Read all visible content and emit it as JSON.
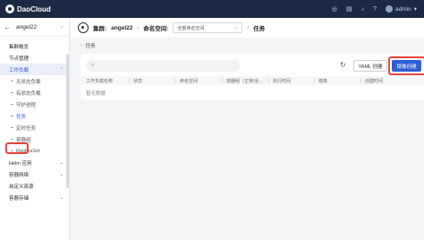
{
  "app": {
    "brand": "DaoCloud",
    "user": "admin"
  },
  "topbar": {
    "icons": [
      "globe-icon",
      "doc-icon",
      "bell-icon",
      "help-icon"
    ]
  },
  "sidebar": {
    "cluster_name": "angel22",
    "items": [
      {
        "label": "集群概览"
      },
      {
        "label": "节点管理"
      },
      {
        "label": "工作负载"
      },
      {
        "label": "无状态负载"
      },
      {
        "label": "有状态负载"
      },
      {
        "label": "守护进程"
      },
      {
        "label": "任务"
      },
      {
        "label": "定时任务"
      },
      {
        "label": "容器组"
      },
      {
        "label": "ReplicaSet"
      },
      {
        "label": "Helm 应用"
      },
      {
        "label": "容器网络"
      },
      {
        "label": "自定义资源"
      },
      {
        "label": "容器存储"
      }
    ]
  },
  "header": {
    "cluster_label": "集群:",
    "cluster_value": "angel22",
    "separator": "/",
    "namespace_label": "命名空间:",
    "namespace_value": "全部命名空间",
    "page_title": "任务"
  },
  "breadcrumb": {
    "text": "任务"
  },
  "toolbar": {
    "yaml_button": "YAML 创建",
    "image_button": "镜像创建"
  },
  "table": {
    "columns": [
      "工作负载名称",
      "状态",
      "命名空间",
      "容器组（正常/全...",
      "执行时间",
      "镜像",
      "创建时间"
    ],
    "empty_text": "暂无数据"
  }
}
